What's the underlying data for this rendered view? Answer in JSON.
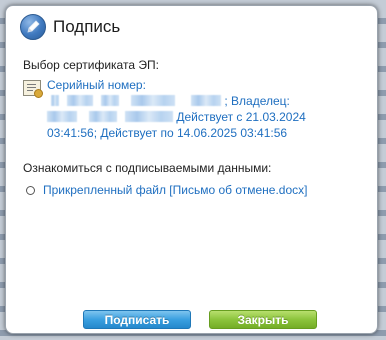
{
  "dialog": {
    "title": "Подпись",
    "select_label": "Выбор сертификата ЭП:",
    "review_label": "Ознакомиться с подписываемыми данными:"
  },
  "certificate": {
    "serial_label": "Серийный номер:",
    "owner_label": "; Владелец:",
    "valid_from": "Действует с 21.03.2024",
    "valid_from_time_and_to": "03:41:56; Действует по 14.06.2025 03:41:56"
  },
  "attachment": {
    "label": "Прикрепленный файл [Письмо об отмене.docx]"
  },
  "buttons": {
    "sign": "Подписать",
    "close": "Закрыть"
  },
  "colors": {
    "link": "#1f6fc0",
    "sign_button": "#3aa0e0",
    "close_button": "#8cc43c"
  }
}
